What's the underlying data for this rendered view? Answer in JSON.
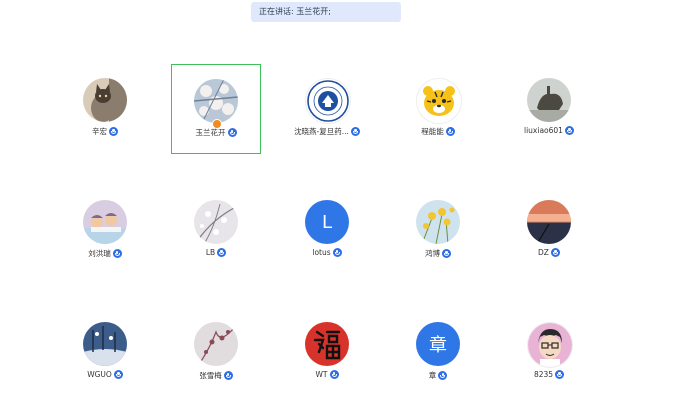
{
  "banner": {
    "text": "正在讲话: 玉兰花开;"
  },
  "participants": [
    {
      "name": "辛宏",
      "avatar_type": "photo",
      "avatar_icon": "cat-photo-icon",
      "colors": [
        "#8a7d6e",
        "#d8cbb8",
        "#4a3e33"
      ]
    },
    {
      "name": "玉兰花开",
      "avatar_type": "photo",
      "avatar_icon": "magnolia-photo-icon",
      "colors": [
        "#b9c7d6",
        "#f3f0ee",
        "#6e8197"
      ],
      "active": true,
      "host": true
    },
    {
      "name": "沈晓燕-复旦药...",
      "avatar_type": "logo",
      "avatar_icon": "university-seal-icon",
      "colors": [
        "#ffffff",
        "#1f4fa0"
      ]
    },
    {
      "name": "程能能",
      "avatar_type": "cartoon",
      "avatar_icon": "tiger-cartoon-icon",
      "colors": [
        "#f6c21a",
        "#2a2a2a"
      ]
    },
    {
      "name": "liuxiao601",
      "avatar_type": "photo",
      "avatar_icon": "sculpture-photo-icon",
      "colors": [
        "#cfd3cf",
        "#4c4a40"
      ]
    },
    {
      "name": "刘洪瑞",
      "avatar_type": "photo",
      "avatar_icon": "children-photo-icon",
      "colors": [
        "#d9cde2",
        "#f0c9a2",
        "#7c6a88"
      ]
    },
    {
      "name": "LB",
      "avatar_type": "photo",
      "avatar_icon": "blossom-photo-icon",
      "colors": [
        "#e7e5ea",
        "#7f7a77"
      ]
    },
    {
      "name": "lotus",
      "avatar_type": "letter",
      "avatar_letter": "L",
      "colors": [
        "#2f76e6"
      ]
    },
    {
      "name": "鸿博",
      "avatar_type": "photo",
      "avatar_icon": "yellow-flowers-photo-icon",
      "colors": [
        "#cfe3ef",
        "#f2c531",
        "#6b8f3a"
      ]
    },
    {
      "name": "DZ",
      "avatar_type": "photo",
      "avatar_icon": "sunset-lake-photo-icon",
      "colors": [
        "#d97a5a",
        "#2b3146",
        "#f4b090"
      ]
    },
    {
      "name": "WGUO",
      "avatar_type": "photo",
      "avatar_icon": "winter-scene-photo-icon",
      "colors": [
        "#3c5d8a",
        "#d9e2ec",
        "#1f2d44"
      ]
    },
    {
      "name": "张雪梅",
      "avatar_type": "photo",
      "avatar_icon": "plum-blossom-photo-icon",
      "colors": [
        "#e1dcdd",
        "#8a4a58"
      ]
    },
    {
      "name": "WT",
      "avatar_type": "calligraphy",
      "avatar_icon": "fu-character-icon",
      "colors": [
        "#d8332a",
        "#111111"
      ]
    },
    {
      "name": "章",
      "avatar_type": "letter",
      "avatar_letter": "章",
      "colors": [
        "#2f76e6"
      ]
    },
    {
      "name": "8235",
      "avatar_type": "cartoon",
      "avatar_icon": "glasses-boy-cartoon-icon",
      "colors": [
        "#e9b3d6",
        "#2a2a2a"
      ]
    }
  ]
}
